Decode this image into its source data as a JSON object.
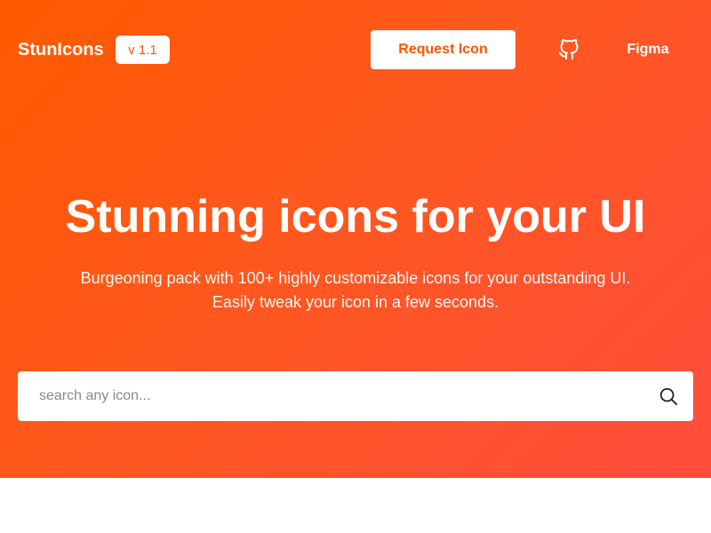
{
  "header": {
    "logo": "StunIcons",
    "version": "v 1.1",
    "request_button": "Request Icon",
    "github_icon": "github-icon",
    "figma_link": "Figma"
  },
  "hero": {
    "title": "Stunning icons for your UI",
    "subtitle_line1": "Burgeoning pack with 100+ highly customizable icons for your outstanding UI.",
    "subtitle_line2": "Easily tweak your icon in a few seconds."
  },
  "search": {
    "placeholder": "search any icon...",
    "value": "",
    "icon": "search-icon"
  },
  "colors": {
    "accent": "#ff5500",
    "gradient_start": "#ff5a00",
    "gradient_end": "#ff4d3d",
    "text_on_accent": "#ffffff"
  }
}
